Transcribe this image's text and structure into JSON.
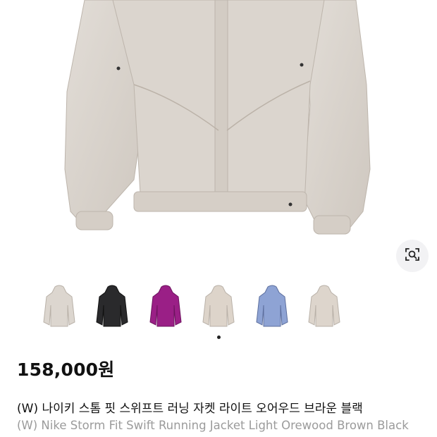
{
  "product": {
    "price": "158,000원",
    "name_ko": "(W) 나이키 스톰 핏 스위프트 러닝 자켓 라이트 오어우드 브라운 블랙",
    "name_en": "(W) Nike Storm Fit Swift Running Jacket Light Orewood Brown Black"
  },
  "gallery": {
    "main_image": "light-orewood-jacket-photo",
    "lens_icon": "visual-search-icon",
    "thumbnails": [
      {
        "color": "#dcd6cf",
        "icon": "jacket-light-orewood"
      },
      {
        "color": "#2a2a2c",
        "icon": "jacket-black"
      },
      {
        "color": "#9a1f86",
        "icon": "jacket-purple"
      },
      {
        "color": "#ddd4ca",
        "icon": "jacket-light-orewood-2"
      },
      {
        "color": "#8ea3d4",
        "icon": "jacket-blue"
      },
      {
        "color": "#ddd5cc",
        "icon": "jacket-light-orewood-3"
      }
    ],
    "page_indicator": {
      "current": 1,
      "total": 1
    }
  }
}
